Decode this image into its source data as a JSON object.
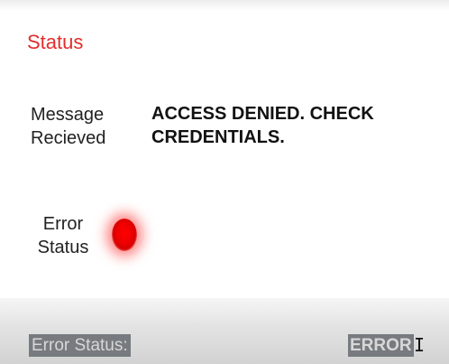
{
  "panel": {
    "title": "Status",
    "message_label": "Message\nRecieved",
    "message_value": "ACCESS DENIED. CHECK\nCREDENTIALS.",
    "error_label": "Error\nStatus",
    "indicator_color": "#ff0000"
  },
  "statusbar": {
    "left_text": "Error Status:",
    "right_text": "ERROR"
  },
  "colors": {
    "title": "#e22d2d",
    "statusbar_highlight": "#777b80"
  }
}
